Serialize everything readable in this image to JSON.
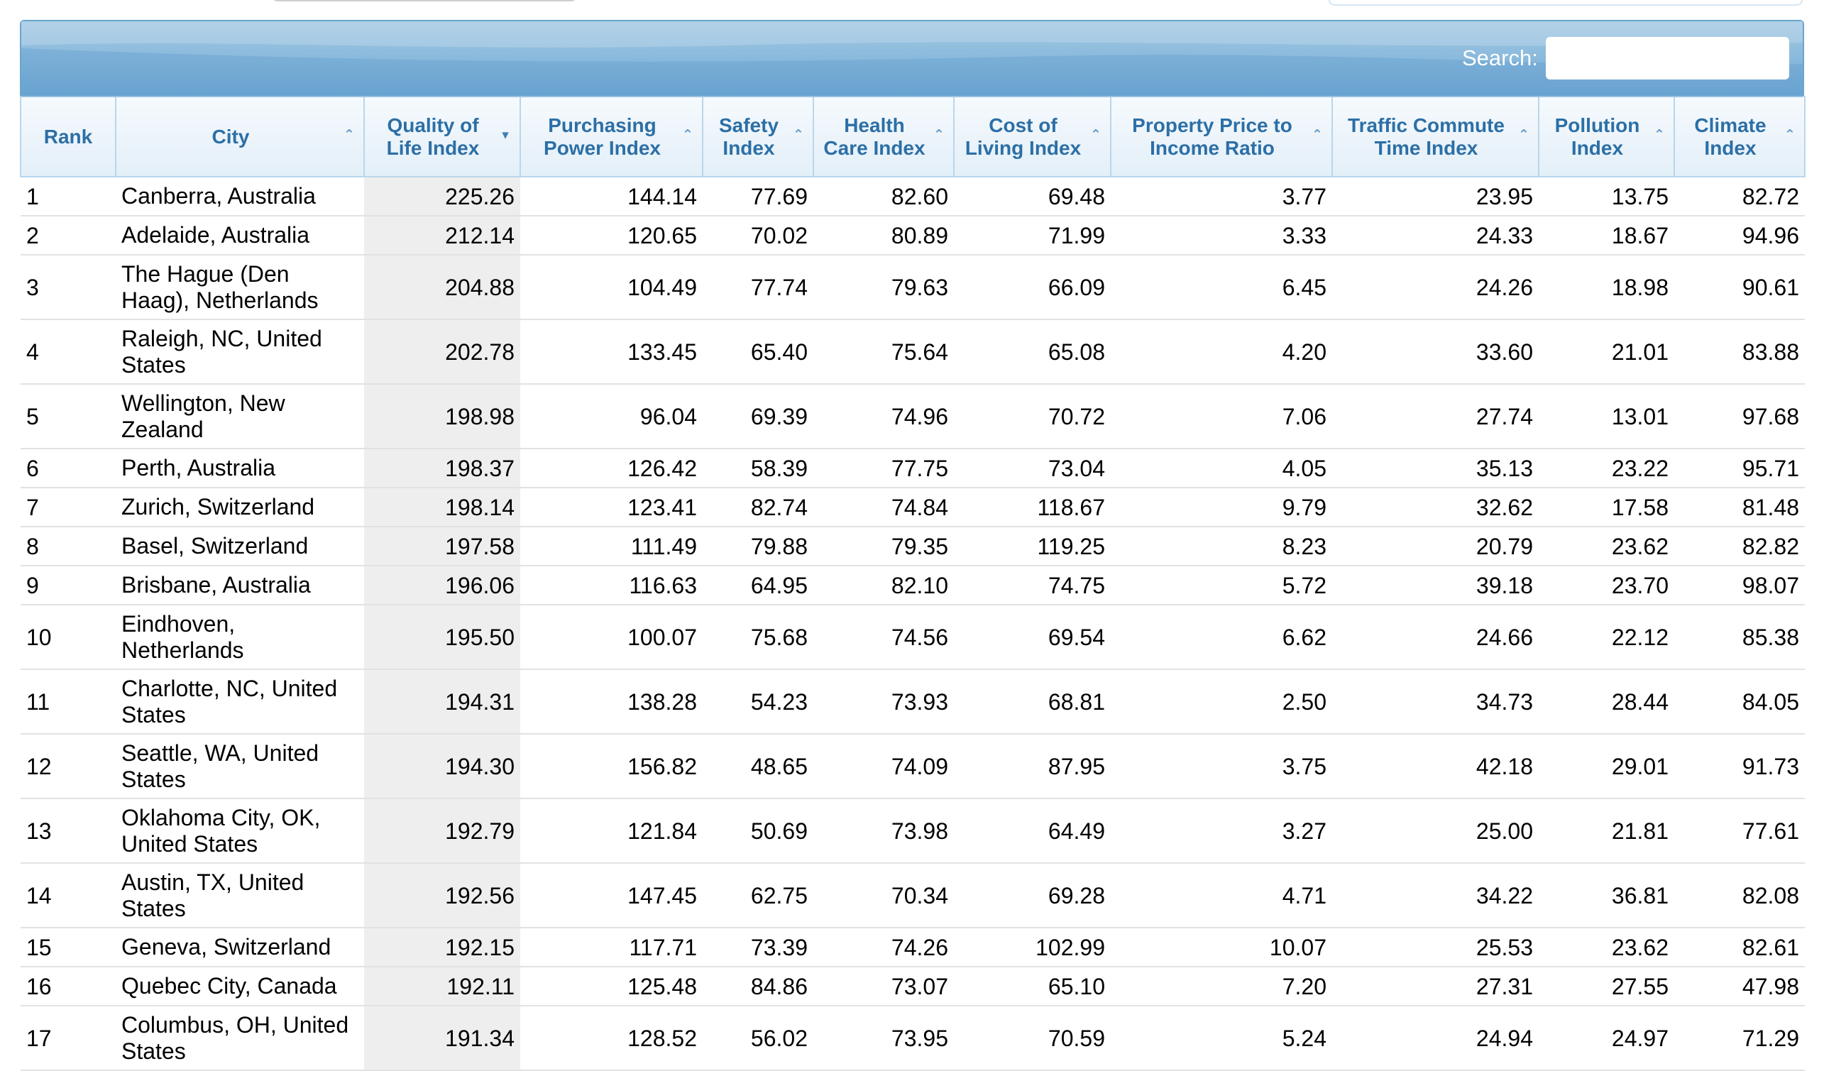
{
  "search": {
    "label": "Search:",
    "value": "",
    "placeholder": ""
  },
  "table": {
    "columns": [
      "Rank",
      "City",
      "Quality of Life Index",
      "Purchasing Power Index",
      "Safety Index",
      "Health Care Index",
      "Cost of Living Index",
      "Property Price to Income Ratio",
      "Traffic Commute Time Index",
      "Pollution Index",
      "Climate Index"
    ],
    "rows": [
      [
        "1",
        "Canberra, Australia",
        "225.26",
        "144.14",
        "77.69",
        "82.60",
        "69.48",
        "3.77",
        "23.95",
        "13.75",
        "82.72"
      ],
      [
        "2",
        "Adelaide, Australia",
        "212.14",
        "120.65",
        "70.02",
        "80.89",
        "71.99",
        "3.33",
        "24.33",
        "18.67",
        "94.96"
      ],
      [
        "3",
        "The Hague (Den Haag), Netherlands",
        "204.88",
        "104.49",
        "77.74",
        "79.63",
        "66.09",
        "6.45",
        "24.26",
        "18.98",
        "90.61"
      ],
      [
        "4",
        "Raleigh, NC, United States",
        "202.78",
        "133.45",
        "65.40",
        "75.64",
        "65.08",
        "4.20",
        "33.60",
        "21.01",
        "83.88"
      ],
      [
        "5",
        "Wellington, New Zealand",
        "198.98",
        "96.04",
        "69.39",
        "74.96",
        "70.72",
        "7.06",
        "27.74",
        "13.01",
        "97.68"
      ],
      [
        "6",
        "Perth, Australia",
        "198.37",
        "126.42",
        "58.39",
        "77.75",
        "73.04",
        "4.05",
        "35.13",
        "23.22",
        "95.71"
      ],
      [
        "7",
        "Zurich, Switzerland",
        "198.14",
        "123.41",
        "82.74",
        "74.84",
        "118.67",
        "9.79",
        "32.62",
        "17.58",
        "81.48"
      ],
      [
        "8",
        "Basel, Switzerland",
        "197.58",
        "111.49",
        "79.88",
        "79.35",
        "119.25",
        "8.23",
        "20.79",
        "23.62",
        "82.82"
      ],
      [
        "9",
        "Brisbane, Australia",
        "196.06",
        "116.63",
        "64.95",
        "82.10",
        "74.75",
        "5.72",
        "39.18",
        "23.70",
        "98.07"
      ],
      [
        "10",
        "Eindhoven, Netherlands",
        "195.50",
        "100.07",
        "75.68",
        "74.56",
        "69.54",
        "6.62",
        "24.66",
        "22.12",
        "85.38"
      ],
      [
        "11",
        "Charlotte, NC, United States",
        "194.31",
        "138.28",
        "54.23",
        "73.93",
        "68.81",
        "2.50",
        "34.73",
        "28.44",
        "84.05"
      ],
      [
        "12",
        "Seattle, WA, United States",
        "194.30",
        "156.82",
        "48.65",
        "74.09",
        "87.95",
        "3.75",
        "42.18",
        "29.01",
        "91.73"
      ],
      [
        "13",
        "Oklahoma City, OK, United States",
        "192.79",
        "121.84",
        "50.69",
        "73.98",
        "64.49",
        "3.27",
        "25.00",
        "21.81",
        "77.61"
      ],
      [
        "14",
        "Austin, TX, United States",
        "192.56",
        "147.45",
        "62.75",
        "70.34",
        "69.28",
        "4.71",
        "34.22",
        "36.81",
        "82.08"
      ],
      [
        "15",
        "Geneva, Switzerland",
        "192.15",
        "117.71",
        "73.39",
        "74.26",
        "102.99",
        "10.07",
        "25.53",
        "23.62",
        "82.61"
      ],
      [
        "16",
        "Quebec City, Canada",
        "192.11",
        "125.48",
        "84.86",
        "73.07",
        "65.10",
        "7.20",
        "27.31",
        "27.55",
        "47.98"
      ],
      [
        "17",
        "Columbus, OH, United States",
        "191.34",
        "128.52",
        "56.02",
        "73.95",
        "70.59",
        "5.24",
        "24.94",
        "24.97",
        "71.29"
      ]
    ]
  },
  "icons": {
    "sort_default": "sort-up-icon",
    "sort_active": "sort-down-icon"
  },
  "colors": {
    "header_text": "#2c6fa6",
    "search_bar": "#8cbbdd",
    "sorted_column_bg": "#eeeeee"
  }
}
